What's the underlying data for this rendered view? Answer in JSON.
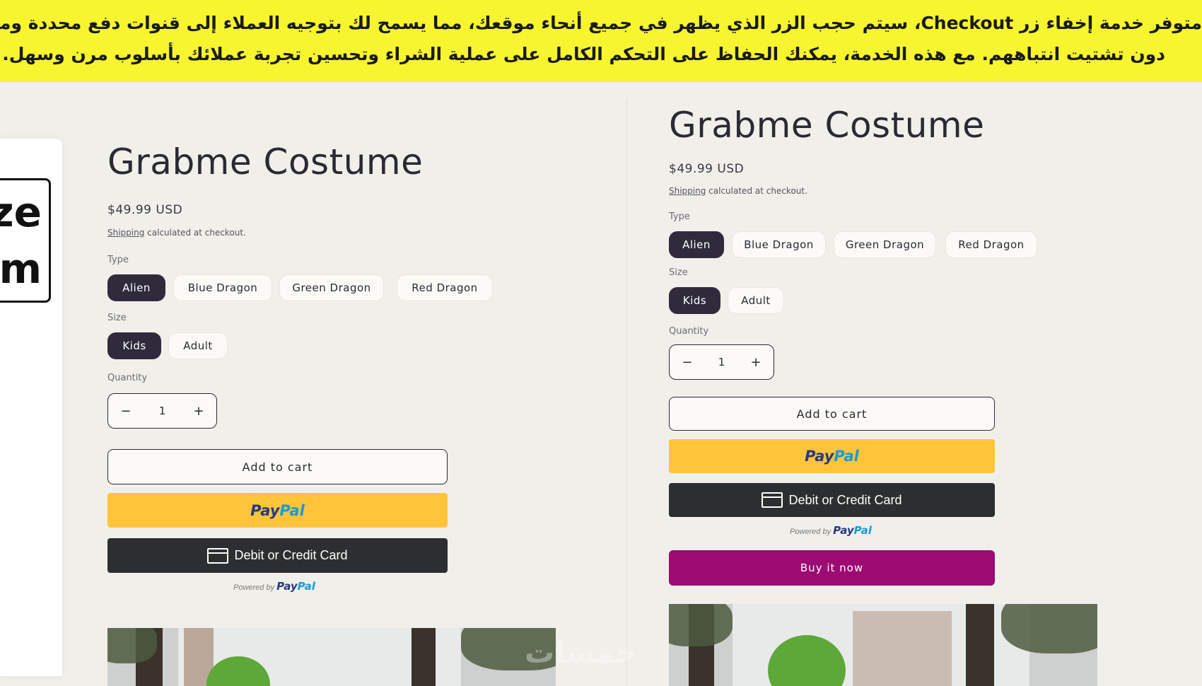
{
  "banner": {
    "line1": "متوفر خدمة إخفاء زر Checkout، سيتم حجب الزر الذي يظهر في جميع أنحاء موقعك، مما يسمح لك بتوجيه العملاء إلى قنوات دفع محددة ومعينة",
    "line2": "دون تشتيت انتباههم. مع هذه الخدمة، يمكنك الحفاظ على التحكم الكامل على عملية الشراء وتحسين تجربة عملائك بأسلوب مرن وسهل."
  },
  "zoom_tile": {
    "text1": "ze",
    "text2": "m"
  },
  "left": {
    "title": "Grabme Costume",
    "price": "$49.99 USD",
    "shipping_link": "Shipping",
    "shipping_rest": " calculated at checkout.",
    "type_label": "Type",
    "types": [
      "Alien",
      "Blue Dragon",
      "Green Dragon",
      "Red Dragon"
    ],
    "size_label": "Size",
    "sizes": [
      "Kids",
      "Adult"
    ],
    "quantity_label": "Quantity",
    "quantity": "1",
    "minus": "−",
    "plus": "+",
    "add_to_cart": "Add to cart",
    "paypal_pay": "Pay",
    "paypal_pal": "Pal",
    "debit": "Debit or Credit Card",
    "powered_by": "Powered by",
    "powered_pay": "Pay",
    "powered_pal": "Pal"
  },
  "right": {
    "title": "Grabme Costume",
    "price": "$49.99 USD",
    "shipping_link": "Shipping",
    "shipping_rest": " calculated at checkout.",
    "type_label": "Type",
    "types": [
      "Alien",
      "Blue Dragon",
      "Green Dragon",
      "Red Dragon"
    ],
    "size_label": "Size",
    "sizes": [
      "Kids",
      "Adult"
    ],
    "quantity_label": "Quantity",
    "quantity": "1",
    "minus": "−",
    "plus": "+",
    "add_to_cart": "Add to cart",
    "paypal_pay": "Pay",
    "paypal_pal": "Pal",
    "debit": "Debit or Credit Card",
    "powered_by": "Powered by",
    "powered_pay": "Pay",
    "powered_pal": "Pal",
    "buy_now": "Buy it now"
  },
  "watermark": "خمسات",
  "colors": {
    "banner_bg": "#f6f52f",
    "page_bg": "#f0efea",
    "selected_pill": "#2f2b3d",
    "paypal_yellow": "#ffc439",
    "debit_dark": "#2c2e2f",
    "buy_now": "#9d0a72"
  }
}
